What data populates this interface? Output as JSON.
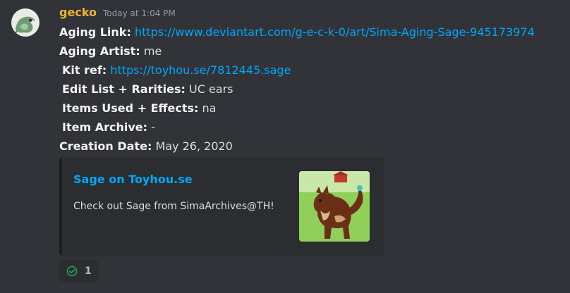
{
  "message": {
    "author": "gecko",
    "author_color": "#f0b232",
    "timestamp": "Today at 1:04 PM",
    "fields": [
      {
        "label": "Aging Link:",
        "value": "https://www.deviantart.com/g-e-c-k-0/art/Sima-Aging-Sage-945173974",
        "is_link": true
      },
      {
        "label": "Aging Artist:",
        "value": "me",
        "is_link": false
      },
      {
        "label": "Kit ref:",
        "value": "https://toyhou.se/7812445.sage",
        "is_link": true
      },
      {
        "label": "Edit List + Rarities:",
        "value": "UC ears",
        "is_link": false
      },
      {
        "label": "Items Used + Effects:",
        "value": "na",
        "is_link": false
      },
      {
        "label": "Item Archive:",
        "value": "-",
        "is_link": false
      },
      {
        "label": "Creation Date:",
        "value": "May 26, 2020",
        "is_link": false
      }
    ]
  },
  "embed": {
    "title": "Sage on Toyhou.se",
    "description": "Check out Sage from SimaArchives@TH!",
    "thumbnail_icon": "character-art-thumbnail"
  },
  "reaction": {
    "emoji": "check-circle-icon",
    "count": "1",
    "accent": "#23a55a"
  },
  "colors": {
    "background": "#313338",
    "link": "#00a8fc",
    "embed_bg": "#2b2d31"
  }
}
